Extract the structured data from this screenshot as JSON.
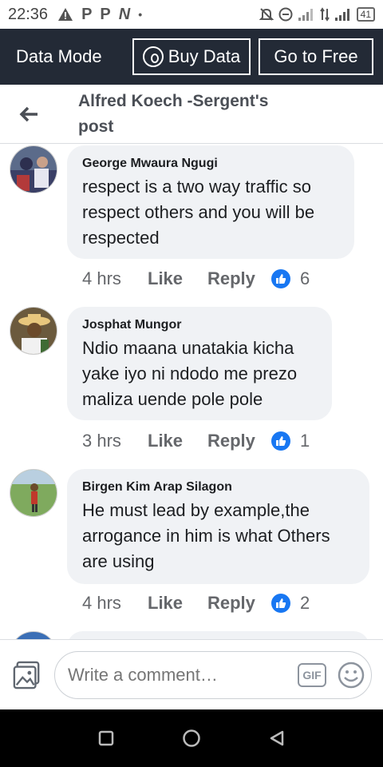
{
  "status_bar": {
    "time": "22:36",
    "left_icons": [
      "warning-icon",
      "p-icon",
      "p-icon",
      "n-icon",
      "dot-icon"
    ],
    "battery": "41"
  },
  "data_bar": {
    "mode_label": "Data Mode",
    "buy_label": "Buy Data",
    "free_label": "Go to Free"
  },
  "header": {
    "title": "Alfred Koech -Sergent's post"
  },
  "comments": [
    {
      "author": "George Mwaura Ngugi",
      "text": "respect is a two way traffic so respect others and you will be respected",
      "time": "4 hrs",
      "like": "Like",
      "reply": "Reply",
      "count": "6"
    },
    {
      "author": "Josphat Mungor",
      "text": "Ndio maana unatakia kicha yake iyo ni ndodo me prezo maliza uende pole pole",
      "time": "3 hrs",
      "like": "Like",
      "reply": "Reply",
      "count": "1"
    },
    {
      "author": "Birgen Kim Arap Silagon",
      "text": "He must lead by example,the arrogance in him is what Others are using",
      "time": "4 hrs",
      "like": "Like",
      "reply": "Reply",
      "count": "2"
    }
  ],
  "composer": {
    "placeholder": "Write a comment…",
    "gif_label": "GIF"
  },
  "colors": {
    "data_bar_bg": "#232a36",
    "bubble_bg": "#f0f2f5",
    "like_blue": "#1877f2"
  }
}
